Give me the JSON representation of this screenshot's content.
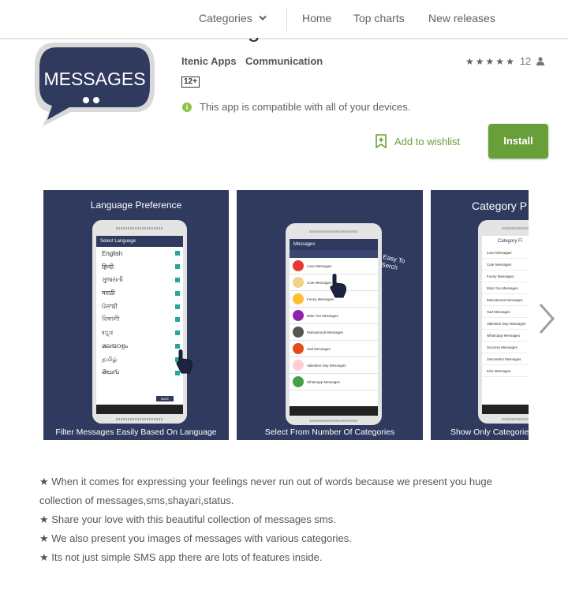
{
  "nav": {
    "categories": "Categories",
    "home": "Home",
    "top_charts": "Top charts",
    "new_releases": "New releases"
  },
  "app": {
    "title": "Messages",
    "icon_text": "MESSAGES",
    "developer": "Itenic Apps",
    "category": "Communication",
    "rating_count": "12",
    "stars": 5,
    "content_rating": "12+",
    "compat_text": "This app is compatible with all of your devices.",
    "wishlist_label": "Add to wishlist",
    "install_label": "Install"
  },
  "screenshots": [
    {
      "header": "Language Preference",
      "footer": "Filter Messages Easily Based On Language",
      "screen_title": "Select Language",
      "languages": [
        "English",
        "हिन्दी",
        "ગુજરાતી",
        "मराठी",
        "ਪੰਜਾਬੀ",
        "বিঙ্গালী",
        "ಕನ್ನಡ",
        "മലയാളം",
        "தமிழ்",
        "తెలుగు"
      ],
      "save_label": "SAVE"
    },
    {
      "header": "",
      "footer": "Select From Number Of Categories",
      "screen_title": "Messages",
      "annotation": "Easy To Serch",
      "rows": [
        "Love Messages",
        "Cute Messages",
        "Funny Messages",
        "Miss You Messages",
        "Motivational Messages",
        "Sad Messages",
        "Valentine Day Messages",
        "Whatsapp Messages"
      ]
    },
    {
      "header": "Category P",
      "footer": "Show Only Categorie",
      "screen_title": "Category Fi",
      "rows": [
        "Love Messages",
        "Cute Messages",
        "Funny Messages",
        "Miss You Messages",
        "Motivational Messages",
        "Sad Messages",
        "Valentine Day Messages",
        "Whatsapp Messages",
        "Success Messages",
        "Janmastmi Messages",
        "Kiss Messages"
      ]
    }
  ],
  "description": [
    "★ When it comes for expressing your feelings never run out of words because we present you huge collection of messages,sms,shayari,status.",
    "★ Share your love with this beautiful collection of messages sms.",
    "★ We also present you images of messages with various categories.",
    "★ Its not just simple SMS app there are lots of features inside."
  ],
  "colors": {
    "accent_green": "#689f38",
    "screenshot_bg": "#2f3a5e",
    "icon_bg": "#2f3a5e"
  },
  "icons": {
    "categories_chevron": "chevron-down-icon",
    "star": "star-icon",
    "person": "person-icon",
    "compat": "info-icon",
    "wishlist": "bookmark-plus-icon",
    "next": "chevron-right-icon"
  }
}
